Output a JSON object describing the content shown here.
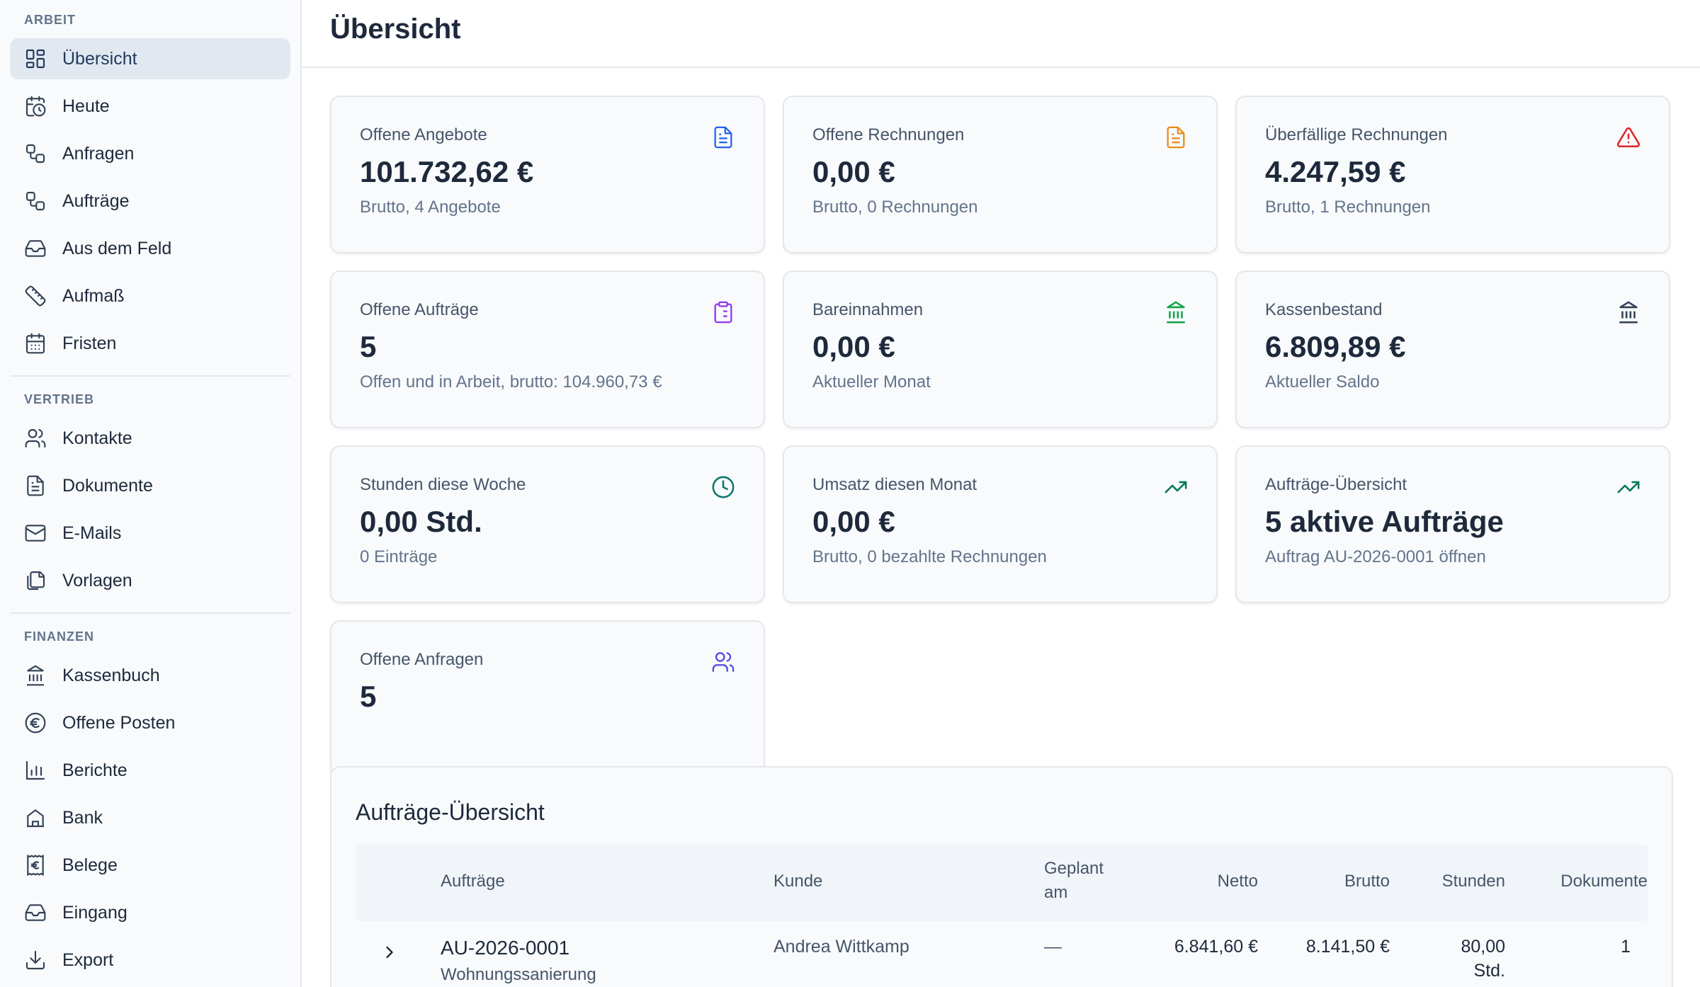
{
  "sidebar": {
    "sections": [
      {
        "label": "ARBEIT",
        "items": [
          {
            "label": "Übersicht",
            "icon": "dashboard-icon",
            "active": true
          },
          {
            "label": "Heute",
            "icon": "calendar-clock-icon"
          },
          {
            "label": "Anfragen",
            "icon": "workflow-icon"
          },
          {
            "label": "Aufträge",
            "icon": "workflow-icon"
          },
          {
            "label": "Aus dem Feld",
            "icon": "inbox-icon"
          },
          {
            "label": "Aufmaß",
            "icon": "ruler-icon"
          },
          {
            "label": "Fristen",
            "icon": "calendar-icon"
          }
        ]
      },
      {
        "label": "VERTRIEB",
        "items": [
          {
            "label": "Kontakte",
            "icon": "users-icon"
          },
          {
            "label": "Dokumente",
            "icon": "document-icon"
          },
          {
            "label": "E-Mails",
            "icon": "mail-icon"
          },
          {
            "label": "Vorlagen",
            "icon": "copy-icon"
          }
        ]
      },
      {
        "label": "FINANZEN",
        "items": [
          {
            "label": "Kassenbuch",
            "icon": "bank-icon"
          },
          {
            "label": "Offene Posten",
            "icon": "euro-circle-icon"
          },
          {
            "label": "Berichte",
            "icon": "bar-chart-icon"
          },
          {
            "label": "Bank",
            "icon": "building-icon"
          },
          {
            "label": "Belege",
            "icon": "receipt-euro-icon"
          },
          {
            "label": "Eingang",
            "icon": "inbox-icon"
          },
          {
            "label": "Export",
            "icon": "download-icon"
          }
        ]
      }
    ]
  },
  "header": {
    "title": "Übersicht"
  },
  "cards": [
    {
      "title": "Offene Angebote",
      "value": "101.732,62 €",
      "sub": "Brutto, 4 Angebote",
      "icon": "document-icon",
      "color": "#2563eb"
    },
    {
      "title": "Offene Rechnungen",
      "value": "0,00 €",
      "sub": "Brutto, 0 Rechnungen",
      "icon": "document-icon",
      "color": "#ea8a18"
    },
    {
      "title": "Überfällige Rechnungen",
      "value": "4.247,59 €",
      "sub": "Brutto, 1 Rechnungen",
      "icon": "warning-icon",
      "color": "#dc2626"
    },
    {
      "title": "Offene Aufträge",
      "value": "5",
      "sub": "Offen und in Arbeit, brutto: 104.960,73 €",
      "icon": "clipboard-icon",
      "color": "#9333ea"
    },
    {
      "title": "Bareinnahmen",
      "value": "0,00 €",
      "sub": "Aktueller Monat",
      "icon": "bank-icon",
      "color": "#16a34a"
    },
    {
      "title": "Kassenbestand",
      "value": "6.809,89 €",
      "sub": "Aktueller Saldo",
      "icon": "bank-icon",
      "color": "#334155"
    },
    {
      "title": "Stunden diese Woche",
      "value": "0,00 Std.",
      "sub": "0 Einträge",
      "icon": "clock-icon",
      "color": "#0f766e"
    },
    {
      "title": "Umsatz diesen Monat",
      "value": "0,00 €",
      "sub": "Brutto, 0 bezahlte Rechnungen",
      "icon": "trending-up-icon",
      "color": "#047857"
    },
    {
      "title": "Aufträge-Übersicht",
      "value": "5 aktive Aufträge",
      "sub": "Auftrag AU-2026-0001 öffnen",
      "icon": "trending-up-icon",
      "color": "#047857"
    },
    {
      "title": "Offene Anfragen",
      "value": "5",
      "sub": "",
      "icon": "users-icon",
      "color": "#4f46e5"
    }
  ],
  "table": {
    "title": "Aufträge-Übersicht",
    "columns": {
      "auftraege": "Aufträge",
      "kunde": "Kunde",
      "geplant_1": "Geplant",
      "geplant_2": "am",
      "netto": "Netto",
      "brutto": "Brutto",
      "stunden": "Stunden",
      "dokumente": "Dokumente"
    },
    "rows": [
      {
        "id": "AU-2026-0001",
        "subtitle": "Wohnungssanierung",
        "kunde": "Andrea Wittkamp",
        "geplant": "—",
        "netto": "6.841,60 €",
        "brutto": "8.141,50 €",
        "stunden_1": "80,00",
        "stunden_2": "Std.",
        "dokumente": "1"
      }
    ]
  }
}
